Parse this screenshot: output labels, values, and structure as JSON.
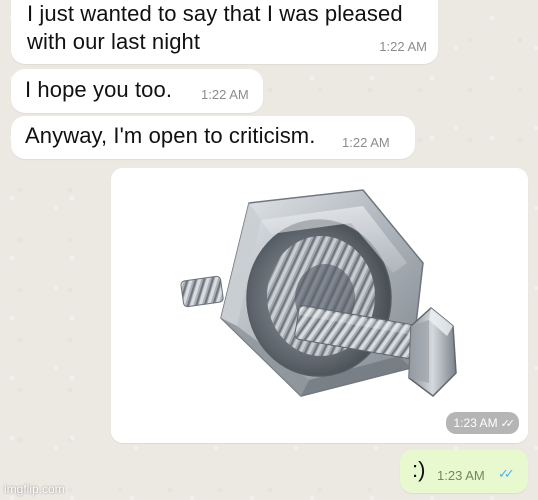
{
  "messages": [
    {
      "text": "I just wanted to say that I was pleased with our last night",
      "time": "1:22 AM"
    },
    {
      "text": "I hope you too.",
      "time": "1:22 AM"
    },
    {
      "text": "Anyway, I'm open to criticism.",
      "time": "1:22 AM"
    }
  ],
  "image_message": {
    "time": "1:23 AM",
    "image": "nut-and-bolt-photo"
  },
  "reply": {
    "text": ":)",
    "time": "1:23 AM"
  },
  "watermark": "imgflip.com",
  "colors": {
    "background": "#ece8e2",
    "incoming_bubble": "#ffffff",
    "outgoing_bubble": "#e9f9cf",
    "read_tick": "#4fb3e8"
  }
}
